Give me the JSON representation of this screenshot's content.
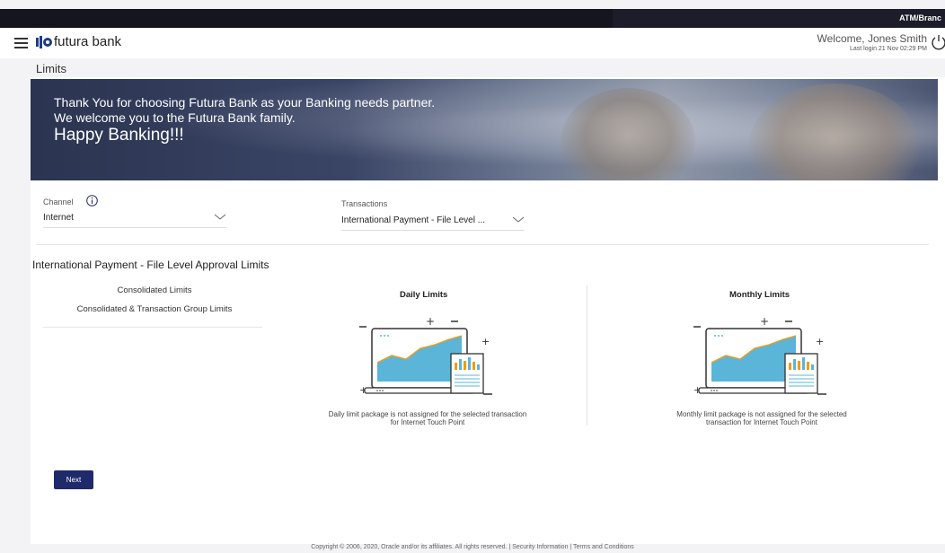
{
  "topbar": {
    "right_text": "ATM/Branc"
  },
  "header": {
    "brand": "futura bank",
    "welcome": "Welcome, Jones Smith",
    "last_login": "Last login 21 Nov 02:29 PM"
  },
  "page_title": "Limits",
  "banner": {
    "line1": "Thank You for choosing Futura Bank as your Banking needs partner.",
    "line2": "We welcome you to the Futura Bank family.",
    "line3": "Happy Banking!!!"
  },
  "filters": {
    "channel_label": "Channel",
    "channel_value": "Internet",
    "transactions_label": "Transactions",
    "transactions_value": "International Payment - File Level ..."
  },
  "section_title": "International Payment - File Level Approval Limits",
  "tabs": [
    {
      "label": "Consolidated Limits"
    },
    {
      "label": "Consolidated & Transaction Group Limits"
    }
  ],
  "daily": {
    "title": "Daily Limits",
    "message": "Daily limit package is not assigned for the selected transaction for Internet Touch Point"
  },
  "monthly": {
    "title": "Monthly Limits",
    "message": "Monthly limit package is not assigned for the selected transaction for Internet Touch Point"
  },
  "next_label": "Next",
  "footer": "Copyright © 2006, 2020, Oracle and/or its affiliates. All rights reserved. | Security Information | Terms and Conditions",
  "colors": {
    "primary": "#1f2a6b",
    "chart_fill": "#5bb5d8",
    "accent": "#f39c12"
  },
  "icons": [
    "hamburger-menu-icon",
    "futura-logo-icon",
    "power-icon",
    "info-icon",
    "chevron-down-icon",
    "laptop-chart-illustration"
  ]
}
